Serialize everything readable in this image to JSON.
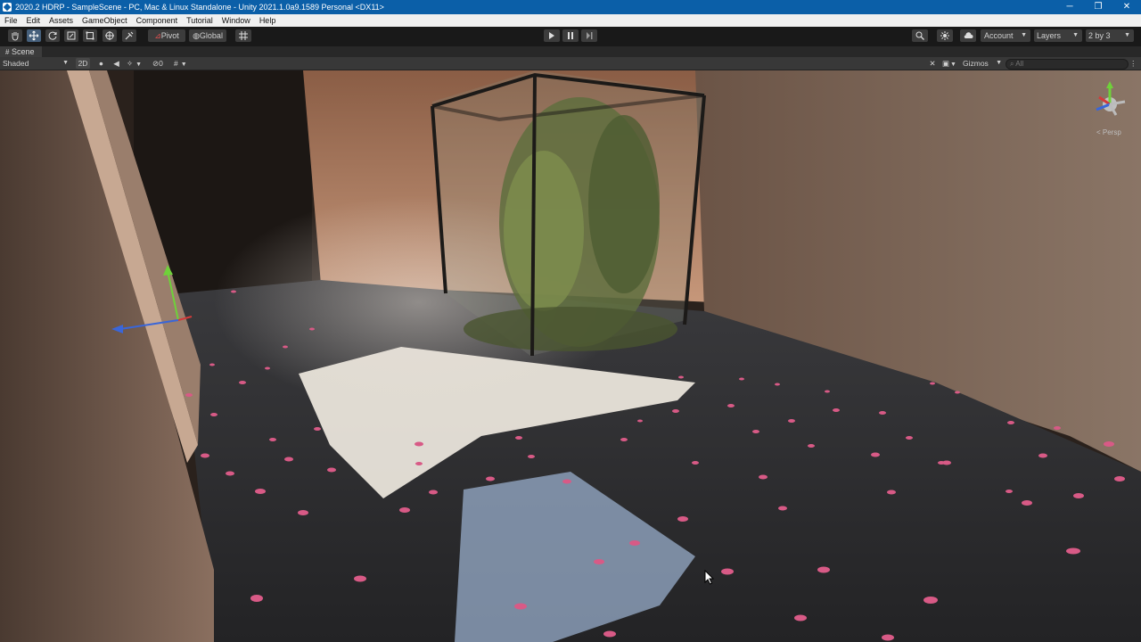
{
  "window": {
    "title": "2020.2 HDRP - SampleScene - PC, Mac & Linux Standalone - Unity 2021.1.0a9.1589 Personal <DX11>",
    "controls": {
      "minimize": "─",
      "restore": "❐",
      "close": "✕"
    }
  },
  "menu": [
    "File",
    "Edit",
    "Assets",
    "GameObject",
    "Component",
    "Tutorial",
    "Window",
    "Help"
  ],
  "toolbar": {
    "pivot_label": "Pivot",
    "global_label": "Global",
    "account_label": "Account",
    "layers_label": "Layers",
    "layout_label": "2 by 3"
  },
  "scene_tab": {
    "label": "Scene"
  },
  "scene_bar": {
    "draw_mode": "Shaded",
    "mode_2d": "2D",
    "hidden_count": "0",
    "gizmos_label": "Gizmos",
    "search_placeholder": "All"
  },
  "orientation_gizmo": {
    "projection_label": "< Persp",
    "axis_x": "x",
    "axis_y": "y",
    "axis_z": "z"
  },
  "colors": {
    "titlebar": "#0b5fa8",
    "active_tool": "#46607c",
    "petal": "#d85a86",
    "gizmo_x": "#d33a3a",
    "gizmo_y": "#6fd13a",
    "gizmo_z": "#3a66d8"
  },
  "icons": {
    "hand": "hand-tool-icon",
    "move": "move-tool-icon",
    "rotate": "rotate-tool-icon",
    "scale": "scale-tool-icon",
    "rect": "rect-tool-icon",
    "transform": "transform-tool-icon",
    "custom": "custom-tool-icon",
    "play": "play-icon",
    "pause": "pause-icon",
    "step": "step-icon",
    "search": "search-icon",
    "collab": "collab-icon",
    "cloud": "cloud-icon"
  }
}
